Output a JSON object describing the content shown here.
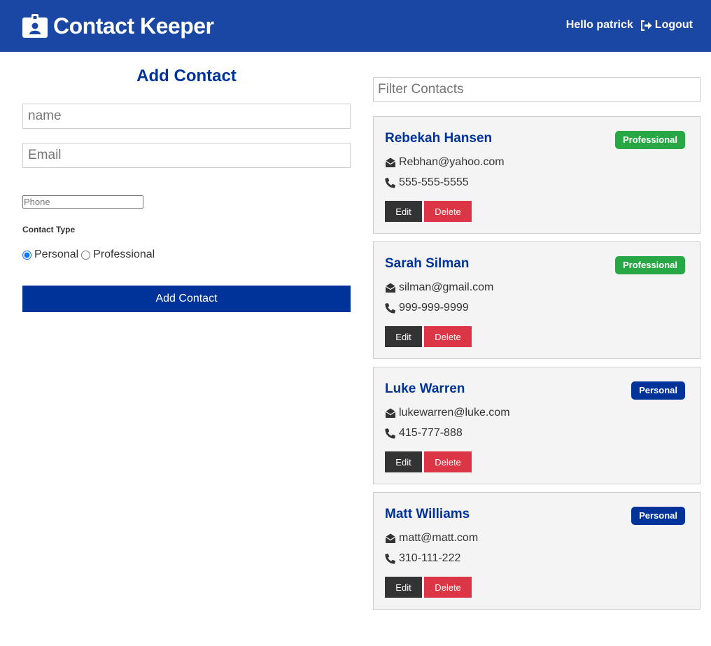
{
  "app": {
    "title": "Contact Keeper",
    "greeting": "Hello patrick",
    "logout_label": "Logout",
    "brand_color": "#1a47a3",
    "icons": {
      "brand": "id-badge-icon",
      "logout": "sign-out-icon",
      "email": "envelope-open-icon",
      "phone": "phone-icon"
    }
  },
  "form": {
    "title": "Add Contact",
    "name_placeholder": "name",
    "email_placeholder": "Email",
    "phone_placeholder": "Phone",
    "type_label": "Contact Type",
    "type_options": [
      {
        "label": "Personal",
        "checked": true
      },
      {
        "label": "Professional",
        "checked": false
      }
    ],
    "submit_label": "Add Contact"
  },
  "filter": {
    "placeholder": "Filter Contacts"
  },
  "contacts": [
    {
      "name": "Rebekah Hansen",
      "email": "Rebhan@yahoo.com",
      "phone": "555-555-5555",
      "type": "Professional",
      "edit_label": "Edit",
      "delete_label": "Delete"
    },
    {
      "name": "Sarah Silman",
      "email": "silman@gmail.com",
      "phone": "999-999-9999",
      "type": "Professional",
      "edit_label": "Edit",
      "delete_label": "Delete"
    },
    {
      "name": "Luke Warren",
      "email": "lukewarren@luke.com",
      "phone": "415-777-888",
      "type": "Personal",
      "edit_label": "Edit",
      "delete_label": "Delete"
    },
    {
      "name": "Matt Williams",
      "email": "matt@matt.com",
      "phone": "310-111-222",
      "type": "Personal",
      "edit_label": "Edit",
      "delete_label": "Delete"
    }
  ],
  "colors": {
    "primary": "#003399",
    "professional": "#28a745",
    "personal": "#003399",
    "danger": "#dc3545",
    "dark": "#333333"
  }
}
